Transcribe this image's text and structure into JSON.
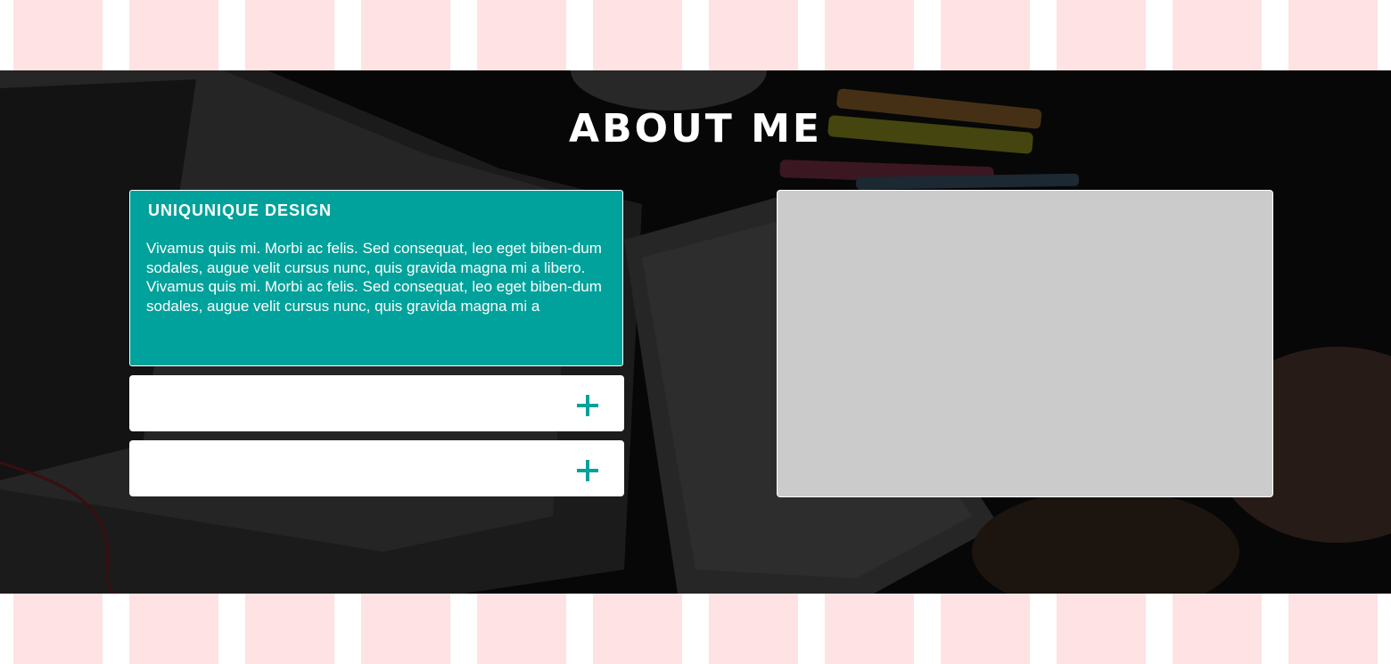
{
  "about": {
    "title": "ABOUT ME",
    "accordion": [
      {
        "heading": "UNIQUNIQUE DESIGN",
        "paragraphs": [
          "Vivamus quis mi. Morbi ac felis. Sed consequat, leo eget biben-dum sodales, augue velit cursus nunc, quis gravida magna mi a libero.",
          "Vivamus quis mi. Morbi ac felis. Sed consequat, leo eget biben-dum sodales, augue velit cursus nunc, quis gravida magna mi a"
        ],
        "expanded": true
      },
      {
        "heading": "",
        "expanded": false,
        "icon": "plus-icon"
      },
      {
        "heading": "",
        "expanded": false,
        "icon": "plus-icon"
      }
    ]
  },
  "colors": {
    "accent": "#00a29b",
    "stripe": "#ffe2e4",
    "media_placeholder": "#cbcbcb",
    "hero_overlay": "#0b0b0b"
  }
}
